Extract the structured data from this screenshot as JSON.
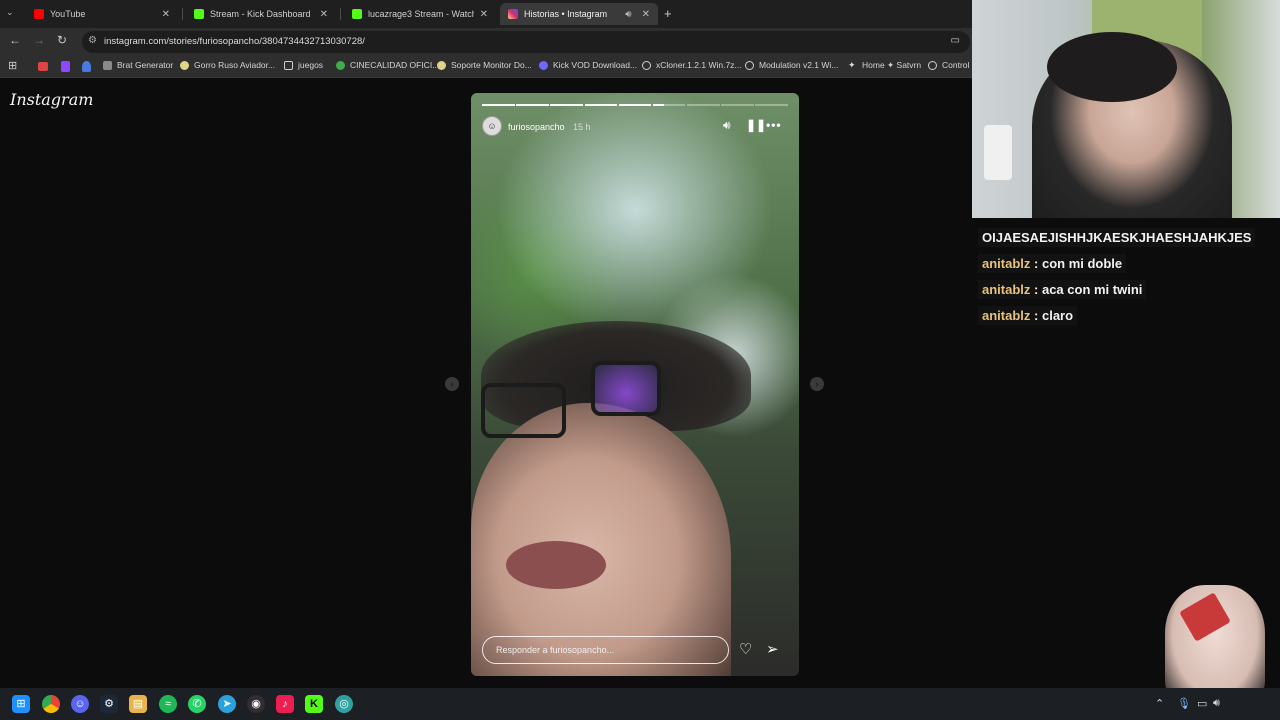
{
  "browser": {
    "tabs": [
      {
        "label": "YouTube",
        "favicon_color": "#ff0000",
        "active": false
      },
      {
        "label": "Stream - Kick Dashboard",
        "favicon_color": "#53fc18",
        "active": false
      },
      {
        "label": "lucazrage3 Stream - Watch Live",
        "favicon_color": "#53fc18",
        "active": false
      },
      {
        "label": "Historias • Instagram",
        "favicon_color": "#e1306c",
        "active": true
      }
    ],
    "url": "instagram.com/stories/furiosopancho/3804734432713030728/",
    "bookmarks": [
      {
        "label": "Brat Generator",
        "icon_color": "#8a8a8a"
      },
      {
        "label": "Gorro Ruso Aviador...",
        "icon_color": "#e0d48a"
      },
      {
        "label": "juegos",
        "icon_color": "#cfcfcf"
      },
      {
        "label": "CINECALIDAD OFICI...",
        "icon_color": "#3fae49"
      },
      {
        "label": "Soporte Monitor Do...",
        "icon_color": "#e0d48a"
      },
      {
        "label": "Kick VOD Download...",
        "icon_color": "#6a6aff"
      },
      {
        "label": "xCloner.1.2.1 Win.7z...",
        "icon_color": "#cfcfcf"
      },
      {
        "label": "Modulation v2.1 Wi...",
        "icon_color": "#cfcfcf"
      },
      {
        "label": "Home ✦ Satvrn",
        "icon_color": "#cfcfcf"
      },
      {
        "label": "Control",
        "icon_color": "#cfcfcf"
      }
    ]
  },
  "instagram": {
    "logo": "Instagram",
    "story": {
      "username": "furiosopancho",
      "time": "15 h",
      "reply_placeholder": "Responder a furiosopancho...",
      "segments_total": 9,
      "segments_complete": 5,
      "current_segment_progress": 0.35
    }
  },
  "chat": {
    "messages": [
      {
        "user": "",
        "text": "OIJAESAEJISHHJKAESKJHAESHJAHKJES"
      },
      {
        "user": "anitablz",
        "text": ": con mi doble"
      },
      {
        "user": "anitablz",
        "text": ": aca con mi twini"
      },
      {
        "user": "anitablz",
        "text": ": claro"
      }
    ]
  },
  "taskbar": {
    "icons": [
      "windows-start",
      "chrome",
      "discord",
      "steam",
      "files",
      "spotify",
      "whatsapp",
      "telegram",
      "obs",
      "tiktok",
      "kick",
      "browser"
    ]
  }
}
